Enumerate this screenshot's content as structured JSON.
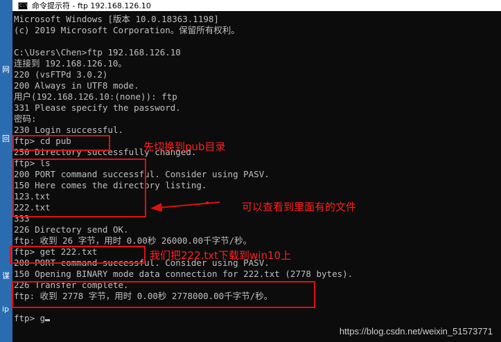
{
  "window": {
    "title": "命令提示符 - ftp 192.168.126.10",
    "icon_label": "C:\\"
  },
  "desktop": {
    "labels": [
      "网",
      "回",
      "谋",
      "ip"
    ]
  },
  "console": {
    "lines": [
      "Microsoft Windows [版本 10.0.18363.1198]",
      "(c) 2019 Microsoft Corporation。保留所有权利。",
      "",
      "C:\\Users\\Chen>ftp 192.168.126.10",
      "连接到 192.168.126.10。",
      "220 (vsFTPd 3.0.2)",
      "200 Always in UTF8 mode.",
      "用户(192.168.126.10:(none)): ftp",
      "331 Please specify the password.",
      "密码:",
      "230 Login successful.",
      "ftp> cd pub",
      "250 Directory successfully changed.",
      "ftp> ls",
      "200 PORT command successful. Consider using PASV.",
      "150 Here comes the directory listing.",
      "123.txt",
      "222.txt",
      "333",
      "226 Directory send OK.",
      "ftp: 收到 26 字节，用时 0.00秒 26000.00千字节/秒。",
      "ftp> get 222.txt",
      "200 PORT command successful. Consider using PASV.",
      "150 Opening BINARY mode data connection for 222.txt (2778 bytes).",
      "226 Transfer complete.",
      "ftp: 收到 2778 字节，用时 0.00秒 2778000.00千字节/秒。",
      "",
      "ftp> g"
    ]
  },
  "annotations": {
    "note_cd": "先切换到pub目录",
    "note_ls": "可以查看到里面有的文件",
    "note_get": "我们把222.txt下载到win10上"
  },
  "colors": {
    "console_bg": "#0c0c0c",
    "console_text": "#c0c0c0",
    "annotation": "#e01010"
  },
  "watermark": "https://blog.csdn.net/weixin_51573771"
}
